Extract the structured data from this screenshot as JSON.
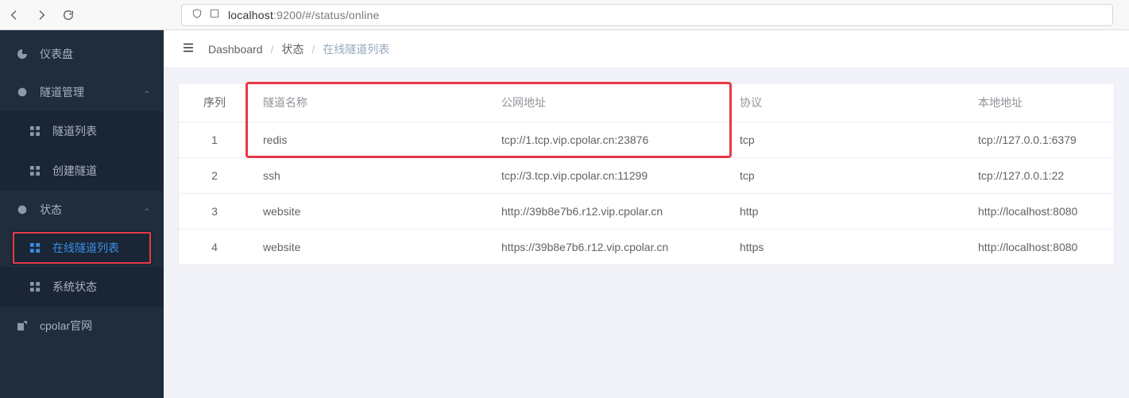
{
  "browser": {
    "url_host": "localhost",
    "url_port_path": ":9200/#/status/online"
  },
  "sidebar": {
    "dashboard": "仪表盘",
    "tunnel_mgmt": "隧道管理",
    "tunnel_list": "隧道列表",
    "create_tunnel": "创建隧道",
    "status": "状态",
    "online_list": "在线隧道列表",
    "system_status": "系统状态",
    "cpolar_site": "cpolar官网"
  },
  "breadcrumb": {
    "dashboard": "Dashboard",
    "status": "状态",
    "online": "在线隧道列表"
  },
  "table": {
    "headers": {
      "idx": "序列",
      "name": "隧道名称",
      "public": "公网地址",
      "proto": "协议",
      "local": "本地地址"
    },
    "rows": [
      {
        "idx": "1",
        "name": "redis",
        "public": "tcp://1.tcp.vip.cpolar.cn:23876",
        "proto": "tcp",
        "local": "tcp://127.0.0.1:6379"
      },
      {
        "idx": "2",
        "name": "ssh",
        "public": "tcp://3.tcp.vip.cpolar.cn:11299",
        "proto": "tcp",
        "local": "tcp://127.0.0.1:22"
      },
      {
        "idx": "3",
        "name": "website",
        "public": "http://39b8e7b6.r12.vip.cpolar.cn",
        "proto": "http",
        "local": "http://localhost:8080"
      },
      {
        "idx": "4",
        "name": "website",
        "public": "https://39b8e7b6.r12.vip.cpolar.cn",
        "proto": "https",
        "local": "http://localhost:8080"
      }
    ]
  },
  "highlight": {
    "row_index": 0
  }
}
